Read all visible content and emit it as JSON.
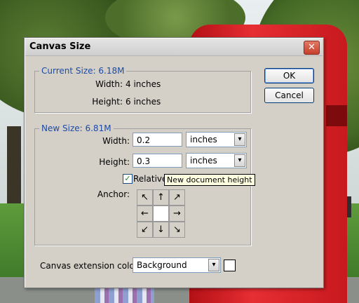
{
  "dialog": {
    "title": "Canvas Size",
    "close_glyph": "✕"
  },
  "current_size": {
    "legend": "Current Size: 6.18M",
    "width_label": "Width:",
    "width_value": "4 inches",
    "height_label": "Height:",
    "height_value": "6 inches"
  },
  "new_size": {
    "legend": "New Size: 6.81M",
    "width_label": "Width:",
    "width_value": "0.2",
    "width_unit": "inches",
    "height_label": "Height:",
    "height_value": "0.3",
    "height_unit": "inches",
    "relative_label": "Relative",
    "relative_checked": true,
    "tooltip": "New document height",
    "anchor_label": "Anchor:",
    "anchor_arrows": [
      "↖",
      "↑",
      "↗",
      "←",
      "",
      "→",
      "↙",
      "↓",
      "↘"
    ]
  },
  "buttons": {
    "ok": "OK",
    "cancel": "Cancel"
  },
  "extension": {
    "label": "Canvas extension color:",
    "value": "Background",
    "swatch_color": "#ffffff"
  },
  "icons": {
    "dropdown": "▾",
    "check": "✓"
  }
}
